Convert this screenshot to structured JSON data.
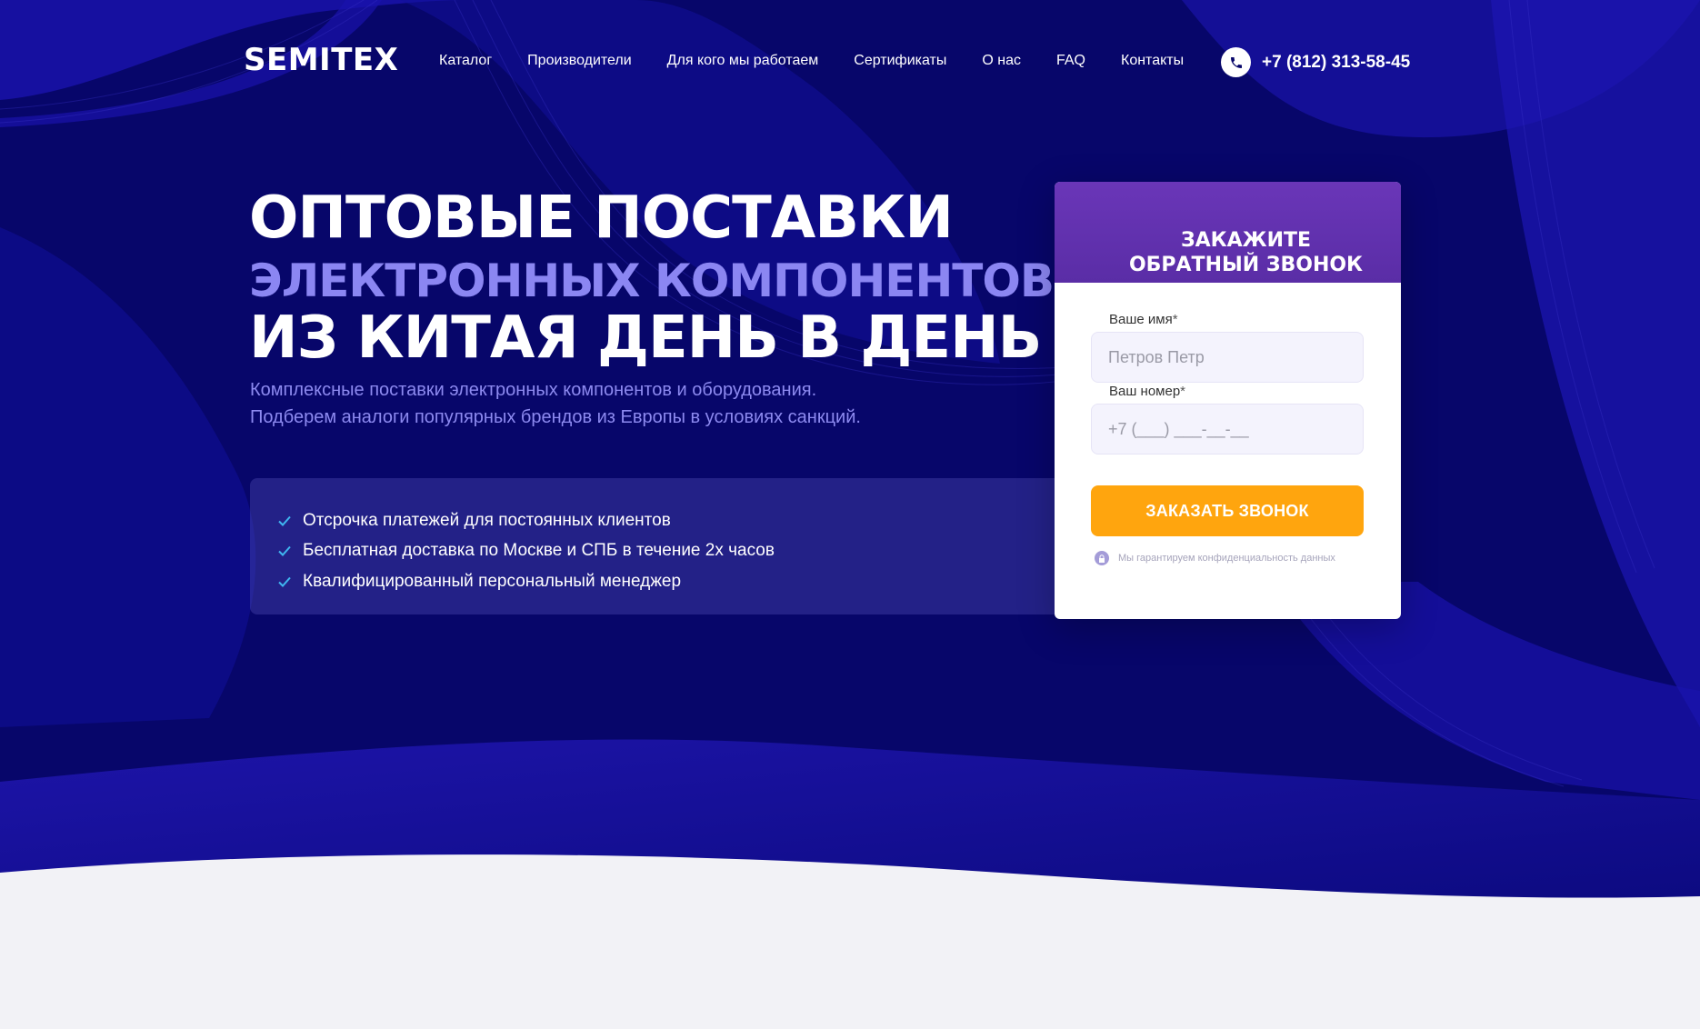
{
  "header": {
    "logo": "SEMITEX",
    "nav": [
      "Каталог",
      "Производители",
      "Для кого мы работаем",
      "Сертификаты",
      "О нас",
      "FAQ",
      "Контакты"
    ],
    "phone": "+7 (812) 313-58-45"
  },
  "hero": {
    "line1": "ОПТОВЫЕ ПОСТАВКИ",
    "line2": "ЭЛЕКТРОННЫХ КОМПОНЕНТОВ",
    "line3": "ИЗ КИТАЯ ДЕНЬ В ДЕНЬ",
    "subtitle1": "Комплексные поставки электронных компонентов и оборудования.",
    "subtitle2": "Подберем аналоги популярных брендов из Европы в условиях санкций.",
    "features": [
      "Отсрочка платежей для постоянных клиентов",
      "Бесплатная доставка по Москве и СПБ в течение 2х часов",
      "Квалифицированный персональный менеджер"
    ]
  },
  "form": {
    "title1": "ЗАКАЖИТЕ",
    "title2": "ОБРАТНЫЙ ЗВОНОК",
    "name_label": "Ваше имя",
    "name_placeholder": "Петров Петр",
    "phone_label": "Ваш номер",
    "phone_placeholder": "+7 (___) ___-__-__",
    "required_mark": "*",
    "submit": "ЗАКАЗАТЬ ЗВОНОК",
    "privacy": "Мы гарантируем конфиденциальность данных"
  },
  "colors": {
    "bg": "#07066a",
    "accent_text": "#8b86f2",
    "button": "#ffa50e",
    "card_head": "#6a36b8"
  }
}
